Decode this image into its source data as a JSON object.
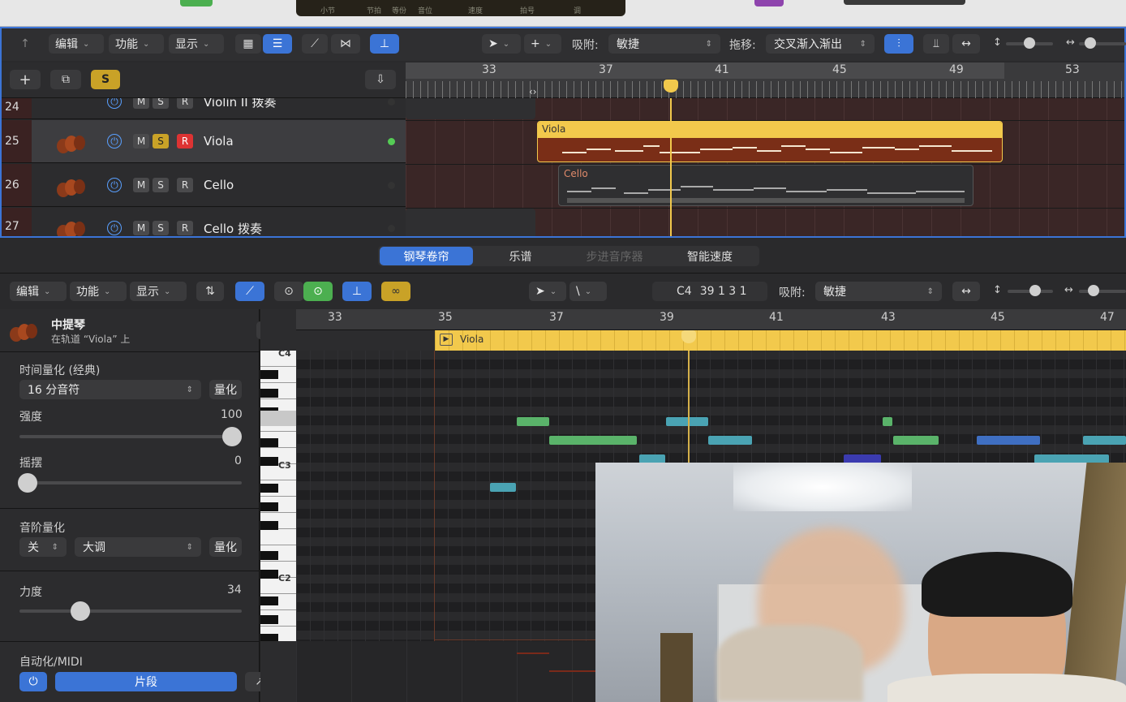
{
  "topbar": {
    "lcd_labels": [
      "小节",
      "节拍",
      "等份",
      "音位",
      "速度",
      "拍号",
      "调"
    ]
  },
  "tracks_toolbar": {
    "edit": "编辑",
    "functions": "功能",
    "view": "显示",
    "snap_label": "吸附:",
    "snap_value": "敏捷",
    "drag_label": "拖移:",
    "drag_value": "交叉渐入渐出",
    "s_button": "S"
  },
  "ruler_top": [
    "33",
    "37",
    "41",
    "45",
    "49",
    "53"
  ],
  "tracks": [
    {
      "num": "24",
      "name": "Violin II 拨奏",
      "m": "M",
      "s": "S",
      "r": "R"
    },
    {
      "num": "25",
      "name": "Viola",
      "m": "M",
      "s": "S",
      "r": "R"
    },
    {
      "num": "26",
      "name": "Cello",
      "m": "M",
      "s": "S",
      "r": "R"
    },
    {
      "num": "27",
      "name": "Cello 拨奏",
      "m": "M",
      "s": "S",
      "r": "R"
    }
  ],
  "regions": {
    "viola": "Viola",
    "cello": "Cello"
  },
  "editor_tabs": [
    "钢琴卷帘",
    "乐谱",
    "步进音序器",
    "智能速度"
  ],
  "editor_toolbar": {
    "edit": "编辑",
    "functions": "功能",
    "view": "显示",
    "position_note": "C4",
    "position_value": "39 1 3 1",
    "snap_label": "吸附:",
    "snap_value": "敏捷"
  },
  "inspector": {
    "inst_name": "中提琴",
    "inst_sub": "在轨道 “Viola” 上",
    "time_quant_label": "时间量化 (经典)",
    "time_quant_value": "16 分音符",
    "quantize_btn": "量化",
    "strength_label": "强度",
    "strength_value": "100",
    "swing_label": "摇摆",
    "swing_value": "0",
    "scale_quant_label": "音阶量化",
    "scale_off": "关",
    "scale_major": "大调",
    "scale_quant_btn": "量化",
    "velocity_label": "力度",
    "velocity_value": "34",
    "automation_label": "自动化/MIDI",
    "region_btn": "片段"
  },
  "editor_ruler": [
    "33",
    "35",
    "37",
    "39",
    "41",
    "43",
    "45",
    "47"
  ],
  "editor_region": "Viola",
  "piano_keys": [
    "C4",
    "C3",
    "C2"
  ],
  "accent_colors": {
    "yellow": "#f2c94c",
    "blue": "#3b74d6",
    "green_note": "#5ab36a",
    "teal_note": "#4aa3b3",
    "blue_note": "#3f6fc2"
  }
}
